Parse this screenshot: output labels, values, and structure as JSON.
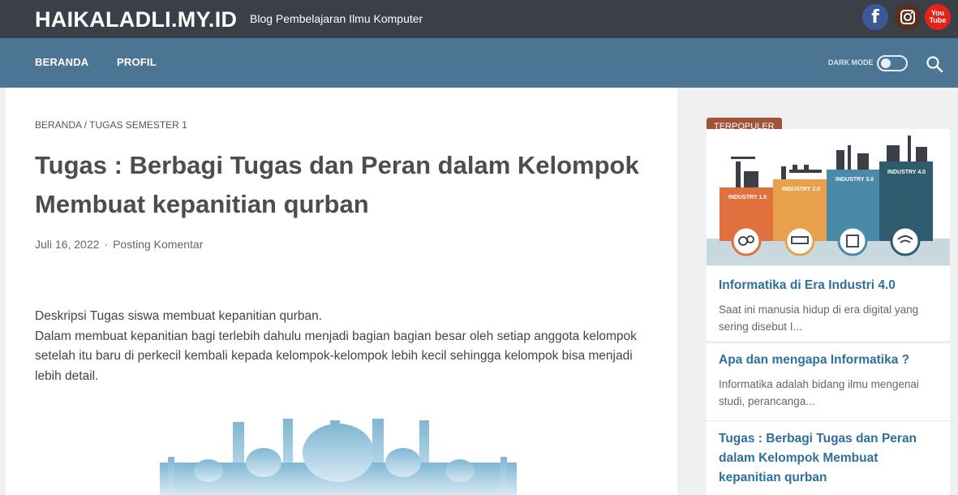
{
  "header": {
    "site_title": "HAIKALADLI.MY.ID",
    "site_description": "Blog Pembelajaran Ilmu Komputer",
    "social_icons": [
      "facebook-icon",
      "instagram-icon",
      "youtube-icon"
    ],
    "youtube_text": "You Tube"
  },
  "nav": {
    "items": [
      "BERANDA",
      "PROFIL"
    ],
    "dark_mode_label": "DARK MODE",
    "dark_mode_on": false
  },
  "article": {
    "breadcrumb": "BERANDA / TUGAS SEMESTER 1",
    "title": "Tugas : Berbagi Tugas dan Peran dalam Kelompok Membuat kepanitian qurban",
    "date": "Juli 16, 2022",
    "meta_separator": "·",
    "comment_link": "Posting Komentar",
    "paragraph_1": "Deskripsi Tugas siswa membuat kepanitian qurban.",
    "paragraph_2": "Dalam membuat kepanitian bagi terlebih dahulu menjadi bagian bagian besar oleh setiap anggota kelompok setelah itu baru di perkecil kembali kepada kelompok-kelompok lebih kecil sehingga kelompok bisa menjadi lebih detail."
  },
  "sidebar": {
    "badge": "TERPOPULER",
    "featured_image_labels": [
      "INDUSTRY 1.0",
      "INDUSTRY 2.0",
      "INDUSTRY 3.0",
      "INDUSTRY 4.0"
    ],
    "posts": [
      {
        "title": "Informatika di Era Industri 4.0",
        "snippet": "Saat ini manusia hidup di era digital yang sering disebut I..."
      },
      {
        "title": "Apa dan mengapa Informatika ?",
        "snippet": "Informatika adalah bidang ilmu mengenai studi, perancanga..."
      },
      {
        "title": "Tugas : Berbagi Tugas dan Peran dalam Kelompok Membuat kepanitian qurban",
        "snippet": ""
      }
    ]
  },
  "colors": {
    "topbar": "#3a3f48",
    "nav": "#4c7493",
    "link": "#2f6f9e",
    "badge": "#a0533a"
  }
}
